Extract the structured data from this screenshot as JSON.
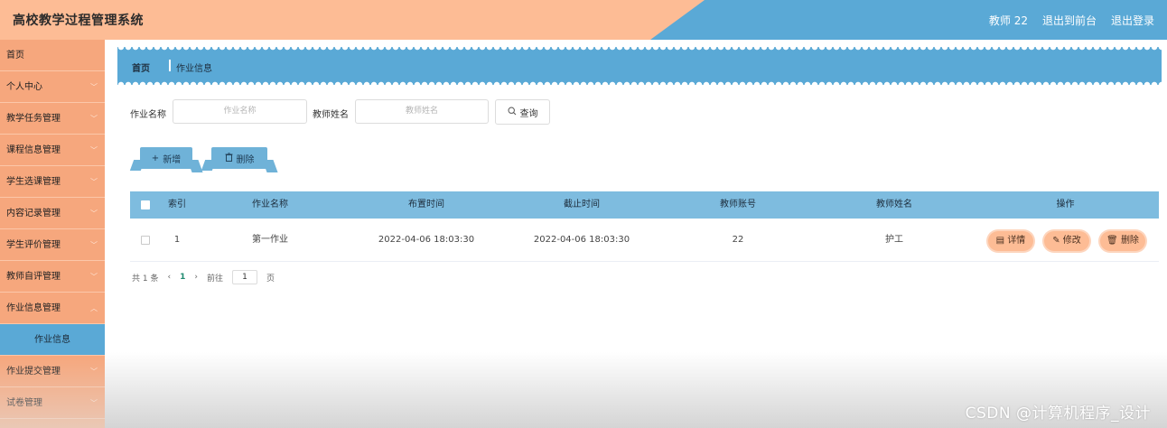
{
  "header": {
    "title": "高校教学过程管理系统",
    "user": "教师 22",
    "back_to_front": "退出到前台",
    "logout": "退出登录"
  },
  "sidebar": {
    "items": [
      {
        "label": "首页"
      },
      {
        "label": "个人中心"
      },
      {
        "label": "教学任务管理"
      },
      {
        "label": "课程信息管理"
      },
      {
        "label": "学生选课管理"
      },
      {
        "label": "内容记录管理"
      },
      {
        "label": "学生评价管理"
      },
      {
        "label": "教师自评管理"
      },
      {
        "label": "作业信息管理"
      },
      {
        "label": "作业信息"
      },
      {
        "label": "作业提交管理"
      },
      {
        "label": "试卷管理"
      }
    ]
  },
  "breadcrumb": {
    "home": "首页",
    "current": "作业信息"
  },
  "search": {
    "name_label": "作业名称",
    "name_placeholder": "作业名称",
    "teacher_label": "教师姓名",
    "teacher_placeholder": "教师姓名",
    "button": "查询"
  },
  "actions": {
    "add": "新增",
    "delete": "删除"
  },
  "table": {
    "headers": [
      "索引",
      "作业名称",
      "布置时间",
      "截止时间",
      "教师账号",
      "教师姓名",
      "操作"
    ],
    "rows": [
      {
        "index": "1",
        "name": "第一作业",
        "assign_time": "2022-04-06 18:03:30",
        "deadline": "2022-04-06 18:03:30",
        "teacher_account": "22",
        "teacher_name": "护工"
      }
    ],
    "ops": {
      "detail": "详情",
      "edit": "修改",
      "delete": "删除"
    }
  },
  "pagination": {
    "total": "共 1 条",
    "prev": "‹",
    "page": "1",
    "next": "›",
    "goto": "前往",
    "goto_value": "1",
    "page_unit": "页"
  },
  "watermark": "CSDN @计算机程序_设计",
  "colors": {
    "header_orange": "#fdbc95",
    "header_blue": "#5aa9d6",
    "sidebar": "#f6a77d",
    "table_header": "#7ebcdf"
  }
}
